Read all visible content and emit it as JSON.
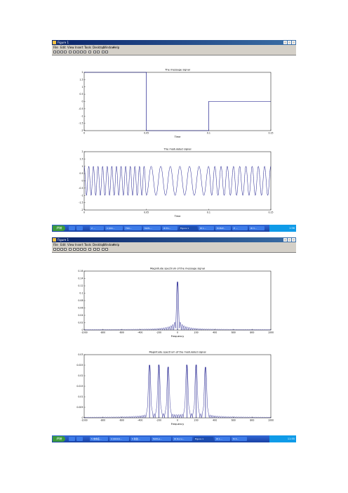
{
  "windows": [
    {
      "title": "Figure 1",
      "menu": [
        "File",
        "Edit",
        "View",
        "Insert",
        "Tools",
        "Desktop",
        "Window",
        "Help"
      ],
      "taskbar": {
        "start": "开始",
        "tasks": [
          "2 ...",
          "C:\\DO...",
          "TOC...",
          "MATL...",
          "W Ex...",
          "Figure 1",
          "W 1...",
          "M MAT...",
          "P ...",
          "W 3..."
        ],
        "clock": "1:56"
      }
    },
    {
      "title": "Figure 1",
      "menu": [
        "File",
        "Edit",
        "View",
        "Insert",
        "Tools",
        "Desktop",
        "Window",
        "Help"
      ],
      "taskbar": {
        "start": "开始",
        "tasks": [
          "5 未命名...",
          "C:\\DOCU...",
          "5 新建...",
          "MATLA...",
          "W Docu...",
          "Figure 1",
          "W 1...",
          "M 3..."
        ],
        "clock": "11:55"
      }
    }
  ],
  "chart_data": [
    {
      "type": "line",
      "title": "The message signal",
      "xlabel": "Time",
      "ylabel": "",
      "xlim": [
        0,
        0.15
      ],
      "ylim": [
        -2,
        2
      ],
      "x_ticks": [
        "0",
        "0.05",
        "0.1",
        "0.15"
      ],
      "y_ticks": [
        "2",
        "1.5",
        "1",
        "0.5",
        "0",
        "-0.5",
        "-1",
        "-1.5",
        "-2"
      ],
      "series": [
        {
          "x": [
            0,
            0.05,
            0.05,
            0.1,
            0.1,
            0.15
          ],
          "y": [
            2,
            2,
            -2,
            -2,
            0,
            0
          ]
        }
      ]
    },
    {
      "type": "line",
      "title": "The modulated signal",
      "xlabel": "Time",
      "ylabel": "",
      "xlim": [
        0,
        0.15
      ],
      "ylim": [
        -2,
        2
      ],
      "x_ticks": [
        "0",
        "0.05",
        "0.1",
        "0.15"
      ],
      "y_ticks": [
        "2",
        "1.5",
        "1",
        "0.5",
        "0",
        "-0.5",
        "-1",
        "-1.5",
        "-2"
      ],
      "segments": [
        {
          "x0": 0,
          "x1": 0.05,
          "cycles": 13.5
        },
        {
          "x0": 0.05,
          "x1": 0.1,
          "cycles": 6.5
        },
        {
          "x0": 0.1,
          "x1": 0.15,
          "cycles": 10
        }
      ],
      "amplitude": 1
    },
    {
      "type": "line",
      "title": "Magnitude spectrum of the message signal",
      "xlabel": "Frequency",
      "ylabel": "",
      "xlim": [
        -1000,
        1000
      ],
      "ylim": [
        0,
        0.16
      ],
      "x_ticks": [
        "-1000",
        "-800",
        "-600",
        "-400",
        "-200",
        "0",
        "200",
        "400",
        "600",
        "800",
        "1000"
      ],
      "y_ticks": [
        "0.16",
        "0.14",
        "0.12",
        "0.1",
        "0.08",
        "0.06",
        "0.04",
        "0.02",
        "0"
      ],
      "peaks": [
        {
          "f": 0,
          "value": 0.118
        }
      ],
      "sidelobe_spacing": 20,
      "sidelobe_scale": 0.9
    },
    {
      "type": "line",
      "title": "Magnitude spectrum of the modulated signal",
      "xlabel": "Frequency",
      "ylabel": "",
      "xlim": [
        -1000,
        1000
      ],
      "ylim": [
        0,
        0.03
      ],
      "x_ticks": [
        "-1000",
        "-800",
        "-600",
        "-400",
        "-200",
        "0",
        "200",
        "400",
        "600",
        "800",
        "1000"
      ],
      "y_ticks": [
        "0.03",
        "0.025",
        "0.02",
        "0.015",
        "0.01",
        "0.005",
        "0"
      ],
      "peaks": [
        {
          "f": -300,
          "value": 0.0245
        },
        {
          "f": -200,
          "value": 0.0245
        },
        {
          "f": -100,
          "value": 0.0235
        },
        {
          "f": 100,
          "value": 0.0245
        },
        {
          "f": 200,
          "value": 0.0245
        },
        {
          "f": 300,
          "value": 0.0235
        }
      ],
      "peak_width": 12,
      "sidelobe_spacing": 20,
      "sidelobe_scale": 0.2
    }
  ],
  "colors": {
    "trace": "#00007f",
    "axes": "#000000",
    "titlebar": "#0a246a",
    "chrome": "#d4d0c8"
  }
}
